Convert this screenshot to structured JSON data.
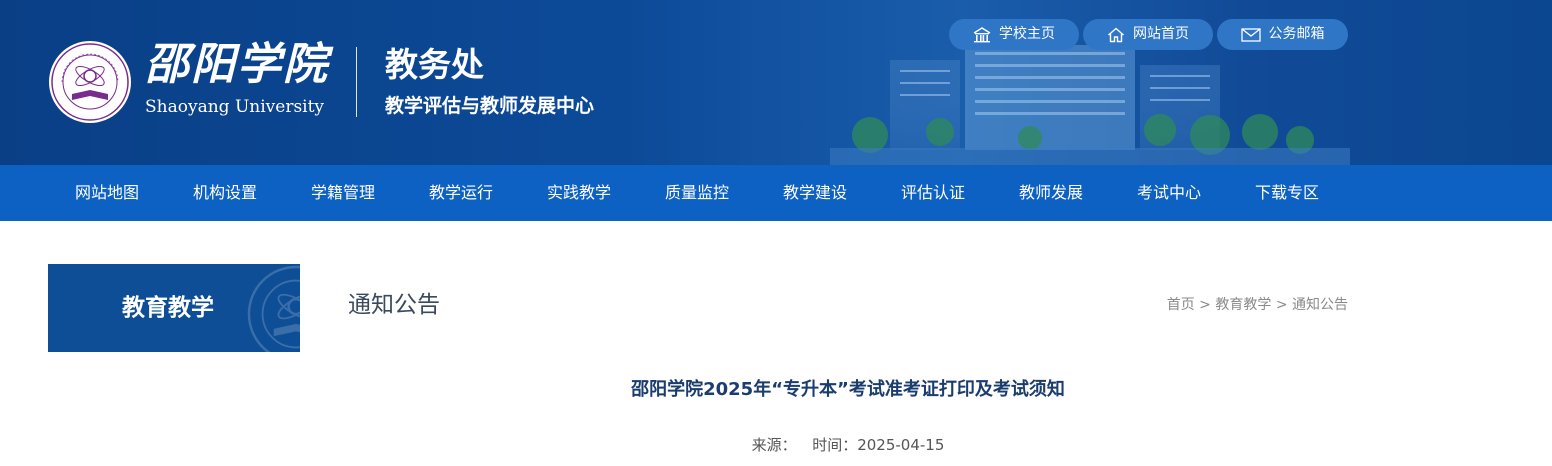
{
  "header": {
    "logo_cn": "邵阳学院",
    "logo_en": "Shaoyang University",
    "dept_title": "教务处",
    "dept_subtitle": "教学评估与教师发展中心",
    "top_links": [
      {
        "label": "学校主页",
        "icon": "school-building-icon"
      },
      {
        "label": "网站首页",
        "icon": "home-icon"
      },
      {
        "label": "公务邮箱",
        "icon": "mail-icon"
      }
    ]
  },
  "nav": {
    "items": [
      "网站地图",
      "机构设置",
      "学籍管理",
      "教学运行",
      "实践教学",
      "质量监控",
      "教学建设",
      "评估认证",
      "教师发展",
      "考试中心",
      "下载专区"
    ]
  },
  "sidebar": {
    "title": "教育教学"
  },
  "section": {
    "title": "通知公告"
  },
  "breadcrumb": {
    "home": "首页",
    "sep": ">",
    "level1": "教育教学",
    "level2": "通知公告"
  },
  "article": {
    "title": "邵阳学院2025年“专升本”考试准考证打印及考试须知",
    "source_label": "来源：",
    "time_label": "时间：",
    "date": "2025-04-15"
  },
  "colors": {
    "header_bg": "#0c4a98",
    "nav_bg": "#0d61c2",
    "sidebar_bg": "#0d4e96",
    "top_link_bg": "#2f76c6",
    "article_title": "#1b3c6e"
  }
}
